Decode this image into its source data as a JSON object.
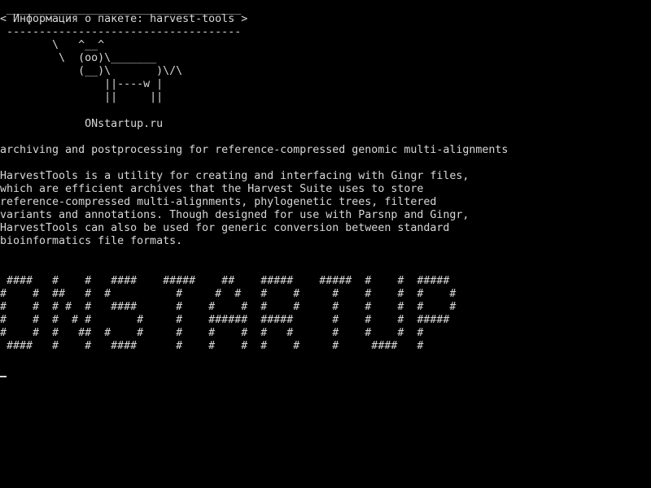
{
  "terminal": {
    "colors": {
      "background": "#000000",
      "foreground": "#d8d8d8"
    },
    "banner": {
      "top_border": " ____________________________________",
      "title": "< Информация о пакете: harvest-tools >",
      "bottom_border": " ------------------------------------"
    },
    "cow": [
      "        \\   ^__^",
      "         \\  (oo)\\_______",
      "            (__)\\       )\\/\\",
      "                ||----w |",
      "                ||     ||"
    ],
    "site": "             ONstartup.ru",
    "summary": "archiving and postprocessing for reference-compressed genomic multi-alignments",
    "description": [
      "HarvestTools is a utility for creating and interfacing with Gingr files,",
      "which are efficient archives that the Harvest Suite uses to store",
      "reference-compressed multi-alignments, phylogenetic trees, filtered",
      "variants and annotations. Though designed for use with Parsnp and Gingr,",
      "HarvestTools can also be used for generic conversion between standard",
      "bioinformatics file formats."
    ],
    "figlet": [
      " ####   #    #   ####    #####    ##    #####    #####  #    #  #####",
      "#    #  ##   #  #          #     #  #   #    #     #    #    #  #    #",
      "#    #  # #  #   ####      #    #    #  #    #     #    #    #  #    #",
      "#    #  #  # #       #     #    ######  #####      #    #    #  #####",
      "#    #  #   ##  #    #     #    #    #  #   #      #    #    #  #",
      " ####   #    #   ####      #    #    #  #    #     #     ####   #"
    ]
  }
}
